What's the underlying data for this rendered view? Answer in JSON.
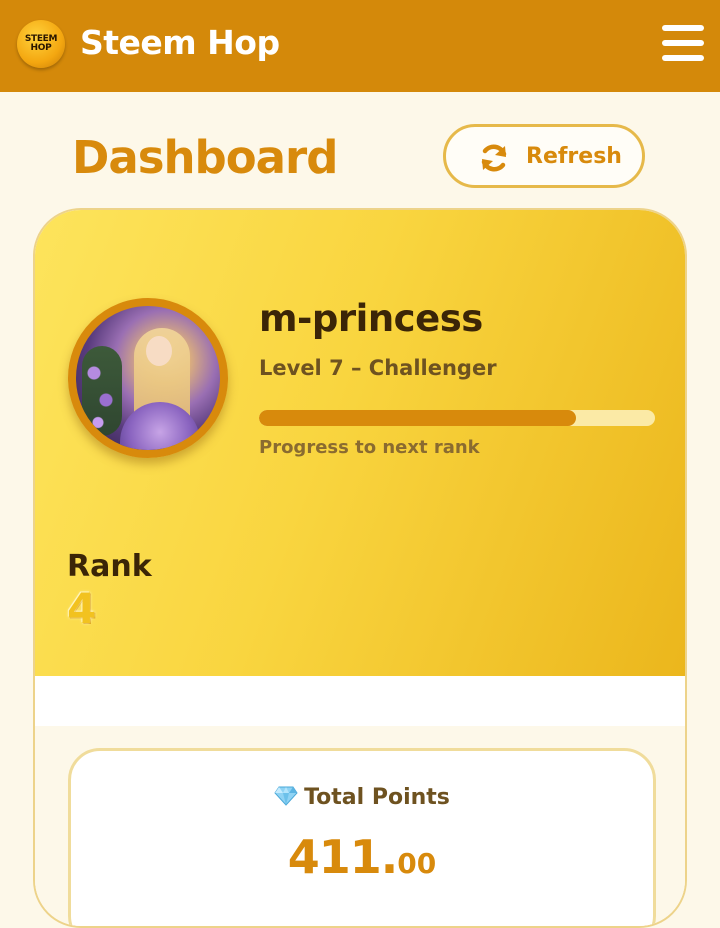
{
  "app": {
    "logo_text": "STEEM HOP",
    "title": "Steem Hop",
    "logo_icon": "steem-hop-logo-icon",
    "menu_icon": "hamburger-menu-icon"
  },
  "page": {
    "title": "Dashboard",
    "refresh_label": "Refresh",
    "refresh_icon": "refresh-icon"
  },
  "profile": {
    "username": "m-princess",
    "level_text": "Level 7 – Challenger",
    "progress_fraction": 0.8,
    "progress_label": "Progress to next rank",
    "rank_label": "Rank",
    "rank_value": "4"
  },
  "points": {
    "title": "Total Points",
    "icon": "gem-icon",
    "value_int": "411.",
    "value_dec": "00"
  },
  "colors": {
    "header": "#d4890a",
    "accent": "#d88a0c",
    "hero_start": "#fde45c",
    "hero_end": "#ebb61c",
    "page_bg": "#fdf8e9"
  }
}
